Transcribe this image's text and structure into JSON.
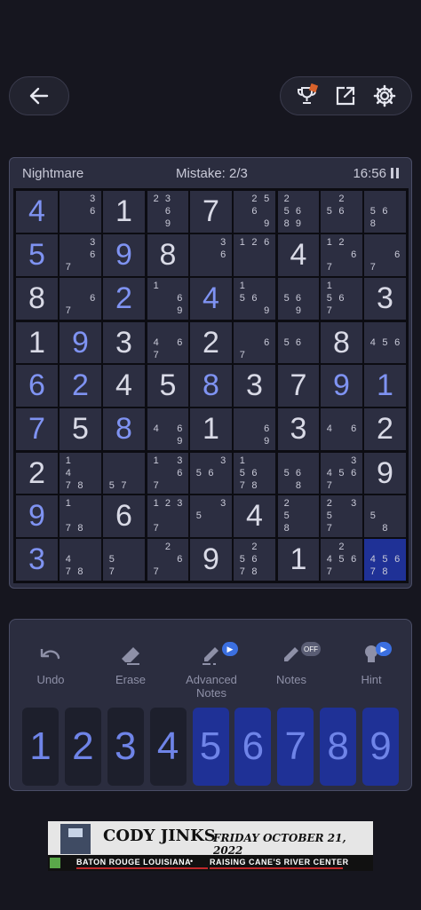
{
  "header": {
    "back_icon": "arrow-left-icon",
    "trophy_icon": "trophy-icon",
    "share_icon": "share-icon",
    "settings_icon": "gear-icon"
  },
  "status": {
    "difficulty": "Nightmare",
    "mistakes": "Mistake: 2/3",
    "timer": "16:56",
    "pause_icon": "pause-icon"
  },
  "board": {
    "selected": [
      8,
      8
    ],
    "rows": [
      [
        {
          "v": "4",
          "u": 1
        },
        {
          "n": [
            0,
            0,
            3,
            0,
            0,
            6,
            0,
            0,
            0
          ]
        },
        {
          "v": "1"
        },
        {
          "n": [
            2,
            3,
            0,
            0,
            6,
            0,
            0,
            9,
            0
          ]
        },
        {
          "v": "7"
        },
        {
          "n": [
            0,
            2,
            5,
            0,
            6,
            0,
            0,
            0,
            9
          ]
        },
        {
          "n": [
            2,
            0,
            0,
            5,
            6,
            0,
            8,
            9,
            0
          ]
        },
        {
          "n": [
            0,
            2,
            0,
            5,
            6,
            0,
            0,
            0,
            0
          ]
        },
        {
          "n": [
            0,
            0,
            0,
            5,
            6,
            0,
            8,
            0,
            0
          ]
        }
      ],
      [
        {
          "v": "5",
          "u": 1
        },
        {
          "n": [
            0,
            0,
            3,
            0,
            0,
            6,
            7,
            0,
            0
          ]
        },
        {
          "v": "9",
          "u": 1
        },
        {
          "v": "8"
        },
        {
          "n": [
            0,
            0,
            3,
            0,
            0,
            6,
            0,
            0,
            0
          ]
        },
        {
          "n": [
            1,
            2,
            6,
            0,
            0,
            0,
            0,
            0,
            0
          ]
        },
        {
          "v": "4"
        },
        {
          "n": [
            1,
            2,
            0,
            0,
            0,
            6,
            7,
            0,
            0
          ]
        },
        {
          "n": [
            0,
            0,
            0,
            0,
            0,
            6,
            7,
            0,
            0
          ]
        }
      ],
      [
        {
          "v": "8"
        },
        {
          "n": [
            0,
            0,
            0,
            0,
            0,
            6,
            7,
            0,
            0
          ]
        },
        {
          "v": "2",
          "u": 1
        },
        {
          "n": [
            1,
            0,
            0,
            0,
            0,
            6,
            0,
            0,
            9
          ]
        },
        {
          "v": "4",
          "u": 1
        },
        {
          "n": [
            1,
            0,
            0,
            5,
            6,
            0,
            0,
            0,
            9
          ]
        },
        {
          "n": [
            0,
            0,
            0,
            5,
            6,
            0,
            0,
            9,
            0
          ]
        },
        {
          "n": [
            1,
            0,
            0,
            5,
            6,
            0,
            7,
            0,
            0
          ]
        },
        {
          "v": "3"
        }
      ],
      [
        {
          "v": "1"
        },
        {
          "v": "9",
          "u": 1
        },
        {
          "v": "3"
        },
        {
          "n": [
            0,
            0,
            0,
            4,
            0,
            6,
            7,
            0,
            0
          ]
        },
        {
          "v": "2"
        },
        {
          "n": [
            0,
            0,
            0,
            0,
            0,
            6,
            7,
            0,
            0
          ]
        },
        {
          "n": [
            0,
            0,
            0,
            5,
            6,
            0,
            0,
            0,
            0
          ]
        },
        {
          "v": "8"
        },
        {
          "n": [
            0,
            0,
            0,
            4,
            5,
            6,
            0,
            0,
            0
          ]
        }
      ],
      [
        {
          "v": "6",
          "u": 1
        },
        {
          "v": "2",
          "u": 1
        },
        {
          "v": "4"
        },
        {
          "v": "5"
        },
        {
          "v": "8",
          "u": 1
        },
        {
          "v": "3"
        },
        {
          "v": "7"
        },
        {
          "v": "9",
          "u": 1
        },
        {
          "v": "1",
          "u": 1
        }
      ],
      [
        {
          "v": "7",
          "u": 1
        },
        {
          "v": "5"
        },
        {
          "v": "8",
          "u": 1
        },
        {
          "n": [
            0,
            0,
            0,
            4,
            0,
            6,
            0,
            0,
            9
          ]
        },
        {
          "v": "1"
        },
        {
          "n": [
            0,
            0,
            0,
            0,
            0,
            6,
            0,
            0,
            9
          ]
        },
        {
          "v": "3"
        },
        {
          "n": [
            0,
            0,
            0,
            4,
            0,
            6,
            0,
            0,
            0
          ]
        },
        {
          "v": "2"
        }
      ],
      [
        {
          "v": "2"
        },
        {
          "n": [
            1,
            0,
            0,
            4,
            0,
            0,
            7,
            8,
            0
          ]
        },
        {
          "n": [
            0,
            0,
            0,
            0,
            0,
            0,
            5,
            7,
            0
          ]
        },
        {
          "n": [
            1,
            0,
            3,
            0,
            0,
            6,
            7,
            0,
            0
          ]
        },
        {
          "n": [
            0,
            0,
            3,
            5,
            6,
            0,
            0,
            0,
            0
          ]
        },
        {
          "n": [
            1,
            0,
            0,
            5,
            6,
            0,
            7,
            8,
            0
          ]
        },
        {
          "n": [
            0,
            0,
            0,
            5,
            6,
            0,
            0,
            8,
            0
          ]
        },
        {
          "n": [
            0,
            0,
            3,
            4,
            5,
            6,
            7,
            0,
            0
          ]
        },
        {
          "v": "9"
        }
      ],
      [
        {
          "v": "9",
          "u": 1
        },
        {
          "n": [
            1,
            0,
            0,
            0,
            0,
            0,
            7,
            8,
            0
          ]
        },
        {
          "v": "6"
        },
        {
          "n": [
            1,
            2,
            3,
            0,
            0,
            0,
            7,
            0,
            0
          ]
        },
        {
          "n": [
            0,
            0,
            3,
            5,
            0,
            0,
            0,
            0,
            0
          ]
        },
        {
          "v": "4"
        },
        {
          "n": [
            2,
            0,
            0,
            5,
            0,
            0,
            8,
            0,
            0
          ]
        },
        {
          "n": [
            2,
            0,
            3,
            5,
            0,
            0,
            7,
            0,
            0
          ]
        },
        {
          "n": [
            0,
            0,
            0,
            5,
            0,
            0,
            0,
            8,
            0
          ]
        }
      ],
      [
        {
          "v": "3",
          "u": 1
        },
        {
          "n": [
            0,
            0,
            0,
            4,
            0,
            0,
            7,
            8,
            0
          ]
        },
        {
          "n": [
            0,
            0,
            0,
            5,
            0,
            0,
            7,
            0,
            0
          ]
        },
        {
          "n": [
            0,
            2,
            0,
            0,
            0,
            6,
            7,
            0,
            0
          ]
        },
        {
          "v": "9"
        },
        {
          "n": [
            0,
            2,
            0,
            5,
            6,
            0,
            7,
            8,
            0
          ]
        },
        {
          "v": "1"
        },
        {
          "n": [
            0,
            2,
            0,
            4,
            5,
            6,
            7,
            0,
            0
          ]
        },
        {
          "n": [
            0,
            0,
            0,
            4,
            5,
            6,
            7,
            8,
            0
          ]
        }
      ]
    ]
  },
  "tools": [
    {
      "label": "Undo",
      "icon": "undo-icon"
    },
    {
      "label": "Erase",
      "icon": "eraser-icon"
    },
    {
      "label": "Advanced\nNotes",
      "icon": "advanced-pencil-icon",
      "badge": "video"
    },
    {
      "label": "Notes",
      "icon": "pencil-icon",
      "badge": "OFF"
    },
    {
      "label": "Hint",
      "icon": "lightbulb-icon",
      "badge": "video"
    }
  ],
  "keypad": [
    "1",
    "2",
    "3",
    "4",
    "5",
    "6",
    "7",
    "8",
    "9"
  ],
  "keypad_highlight": [
    4,
    5,
    6,
    7,
    8
  ],
  "ad": {
    "name": "CODY JINKS",
    "date": "FRIDAY OCTOBER 21, 2022",
    "location_left": "BATON ROUGE LOUISIANA",
    "separator": "•",
    "location_right": "RAISING CANE'S RIVER CENTER"
  },
  "colors": {
    "background": "#16161f",
    "panel": "#2b2d3f",
    "accent": "#7f93f2",
    "selected": "#1f3196"
  }
}
